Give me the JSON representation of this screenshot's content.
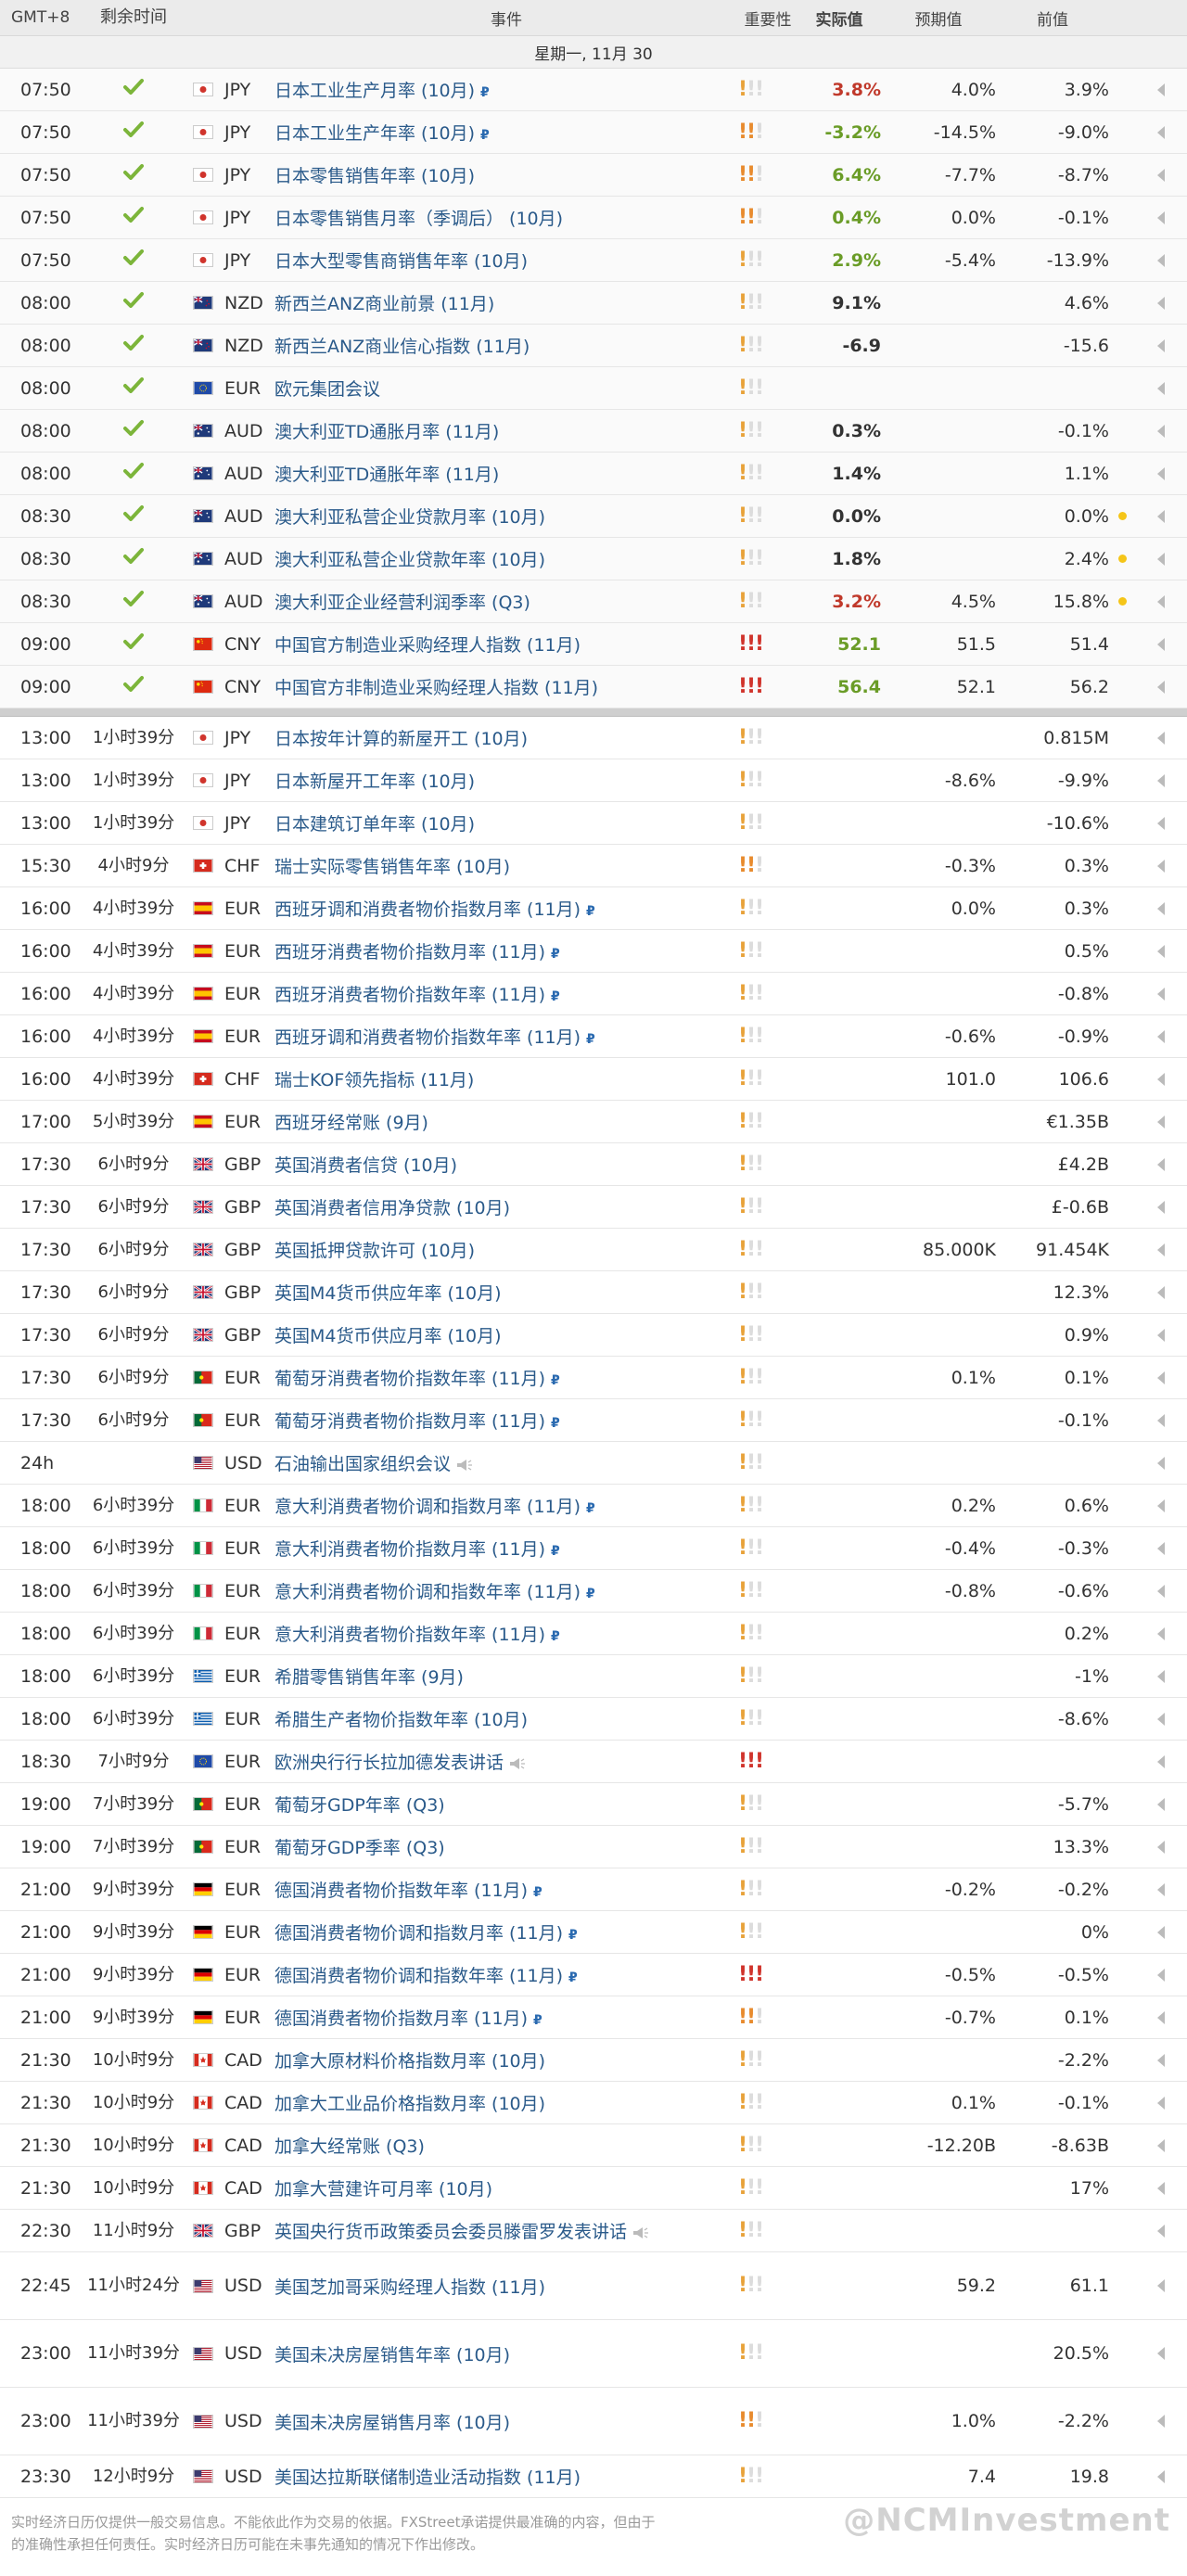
{
  "header": {
    "tz": "GMT+8",
    "remain": "剩余时间",
    "event": "事件",
    "importance": "重要性",
    "actual": "实际值",
    "forecast": "预期值",
    "previous": "前值"
  },
  "date": "星期一, 11月 30",
  "done_rows": [
    {
      "time": "07:50",
      "flag": "jp",
      "cur": "JPY",
      "event": "日本工业生产月率 (10月)",
      "rev": true,
      "imp": 1,
      "actual": "3.8%",
      "actual_class": "neg",
      "forecast": "4.0%",
      "previous": "3.9%",
      "dot": false
    },
    {
      "time": "07:50",
      "flag": "jp",
      "cur": "JPY",
      "event": "日本工业生产年率 (10月)",
      "rev": true,
      "imp": 2,
      "actual": "-3.2%",
      "actual_class": "pos",
      "forecast": "-14.5%",
      "previous": "-9.0%",
      "dot": false
    },
    {
      "time": "07:50",
      "flag": "jp",
      "cur": "JPY",
      "event": "日本零售销售年率 (10月)",
      "rev": false,
      "imp": 2,
      "actual": "6.4%",
      "actual_class": "pos",
      "forecast": "-7.7%",
      "previous": "-8.7%",
      "dot": false
    },
    {
      "time": "07:50",
      "flag": "jp",
      "cur": "JPY",
      "event": "日本零售销售月率（季调后） (10月)",
      "rev": false,
      "imp": 2,
      "actual": "0.4%",
      "actual_class": "pos",
      "forecast": "0.0%",
      "previous": "-0.1%",
      "dot": false
    },
    {
      "time": "07:50",
      "flag": "jp",
      "cur": "JPY",
      "event": "日本大型零售商销售年率 (10月)",
      "rev": false,
      "imp": 1,
      "actual": "2.9%",
      "actual_class": "pos",
      "forecast": "-5.4%",
      "previous": "-13.9%",
      "dot": false
    },
    {
      "time": "08:00",
      "flag": "nz",
      "cur": "NZD",
      "event": "新西兰ANZ商业前景 (11月)",
      "rev": false,
      "imp": 0,
      "actual": "9.1%",
      "actual_class": "",
      "forecast": "",
      "previous": "4.6%",
      "dot": false
    },
    {
      "time": "08:00",
      "flag": "nz",
      "cur": "NZD",
      "event": "新西兰ANZ商业信心指数 (11月)",
      "rev": false,
      "imp": 0,
      "actual": "-6.9",
      "actual_class": "",
      "forecast": "",
      "previous": "-15.6",
      "dot": false
    },
    {
      "time": "08:00",
      "flag": "eu",
      "cur": "EUR",
      "event": "欧元集团会议",
      "rev": false,
      "imp": 0,
      "actual": "",
      "actual_class": "",
      "forecast": "",
      "previous": "",
      "dot": false
    },
    {
      "time": "08:00",
      "flag": "au",
      "cur": "AUD",
      "event": "澳大利亚TD通胀月率 (11月)",
      "rev": false,
      "imp": 0,
      "actual": "0.3%",
      "actual_class": "",
      "forecast": "",
      "previous": "-0.1%",
      "dot": false
    },
    {
      "time": "08:00",
      "flag": "au",
      "cur": "AUD",
      "event": "澳大利亚TD通胀年率 (11月)",
      "rev": false,
      "imp": 0,
      "actual": "1.4%",
      "actual_class": "",
      "forecast": "",
      "previous": "1.1%",
      "dot": false
    },
    {
      "time": "08:30",
      "flag": "au",
      "cur": "AUD",
      "event": "澳大利亚私营企业贷款月率 (10月)",
      "rev": false,
      "imp": 0,
      "actual": "0.0%",
      "actual_class": "",
      "forecast": "",
      "previous": "0.0%",
      "dot": true
    },
    {
      "time": "08:30",
      "flag": "au",
      "cur": "AUD",
      "event": "澳大利亚私营企业贷款年率 (10月)",
      "rev": false,
      "imp": 0,
      "actual": "1.8%",
      "actual_class": "",
      "forecast": "",
      "previous": "2.4%",
      "dot": true
    },
    {
      "time": "08:30",
      "flag": "au",
      "cur": "AUD",
      "event": "澳大利亚企业经营利润季率 (Q3)",
      "rev": false,
      "imp": 0,
      "actual": "3.2%",
      "actual_class": "neg",
      "forecast": "4.5%",
      "previous": "15.8%",
      "dot": true
    },
    {
      "time": "09:00",
      "flag": "cn",
      "cur": "CNY",
      "event": "中国官方制造业采购经理人指数 (11月)",
      "rev": false,
      "imp": 3,
      "actual": "52.1",
      "actual_class": "pos",
      "forecast": "51.5",
      "previous": "51.4",
      "dot": false
    },
    {
      "time": "09:00",
      "flag": "cn",
      "cur": "CNY",
      "event": "中国官方非制造业采购经理人指数 (11月)",
      "rev": false,
      "imp": 3,
      "actual": "56.4",
      "actual_class": "pos",
      "forecast": "52.1",
      "previous": "56.2",
      "dot": false
    }
  ],
  "pending_rows": [
    {
      "time": "13:00",
      "remain": "1小时39分",
      "flag": "jp",
      "cur": "JPY",
      "event": "日本按年计算的新屋开工 (10月)",
      "rev": false,
      "speech": false,
      "imp": 0,
      "forecast": "",
      "previous": "0.815M",
      "tall": false
    },
    {
      "time": "13:00",
      "remain": "1小时39分",
      "flag": "jp",
      "cur": "JPY",
      "event": "日本新屋开工年率 (10月)",
      "rev": false,
      "speech": false,
      "imp": 0,
      "forecast": "-8.6%",
      "previous": "-9.9%",
      "tall": false
    },
    {
      "time": "13:00",
      "remain": "1小时39分",
      "flag": "jp",
      "cur": "JPY",
      "event": "日本建筑订单年率 (10月)",
      "rev": false,
      "speech": false,
      "imp": 0,
      "forecast": "",
      "previous": "-10.6%",
      "tall": false
    },
    {
      "time": "15:30",
      "remain": "4小时9分",
      "flag": "ch",
      "cur": "CHF",
      "event": "瑞士实际零售销售年率 (10月)",
      "rev": false,
      "speech": false,
      "imp": 2,
      "forecast": "-0.3%",
      "previous": "0.3%",
      "tall": false
    },
    {
      "time": "16:00",
      "remain": "4小时39分",
      "flag": "es",
      "cur": "EUR",
      "event": "西班牙调和消费者物价指数月率 (11月)",
      "rev": true,
      "speech": false,
      "imp": 1,
      "forecast": "0.0%",
      "previous": "0.3%",
      "tall": false
    },
    {
      "time": "16:00",
      "remain": "4小时39分",
      "flag": "es",
      "cur": "EUR",
      "event": "西班牙消费者物价指数月率 (11月)",
      "rev": true,
      "speech": false,
      "imp": 1,
      "forecast": "",
      "previous": "0.5%",
      "tall": false
    },
    {
      "time": "16:00",
      "remain": "4小时39分",
      "flag": "es",
      "cur": "EUR",
      "event": "西班牙消费者物价指数年率 (11月)",
      "rev": true,
      "speech": false,
      "imp": 1,
      "forecast": "",
      "previous": "-0.8%",
      "tall": false
    },
    {
      "time": "16:00",
      "remain": "4小时39分",
      "flag": "es",
      "cur": "EUR",
      "event": "西班牙调和消费者物价指数年率 (11月)",
      "rev": true,
      "speech": false,
      "imp": 1,
      "forecast": "-0.6%",
      "previous": "-0.9%",
      "tall": false
    },
    {
      "time": "16:00",
      "remain": "4小时39分",
      "flag": "ch",
      "cur": "CHF",
      "event": "瑞士KOF领先指标 (11月)",
      "rev": false,
      "speech": false,
      "imp": 1,
      "forecast": "101.0",
      "previous": "106.6",
      "tall": false
    },
    {
      "time": "17:00",
      "remain": "5小时39分",
      "flag": "es",
      "cur": "EUR",
      "event": "西班牙经常账 (9月)",
      "rev": false,
      "speech": false,
      "imp": 0,
      "forecast": "",
      "previous": "€1.35B",
      "tall": false
    },
    {
      "time": "17:30",
      "remain": "6小时9分",
      "flag": "gb",
      "cur": "GBP",
      "event": "英国消费者信贷 (10月)",
      "rev": false,
      "speech": false,
      "imp": 1,
      "forecast": "",
      "previous": "£4.2B",
      "tall": false
    },
    {
      "time": "17:30",
      "remain": "6小时9分",
      "flag": "gb",
      "cur": "GBP",
      "event": "英国消费者信用净贷款 (10月)",
      "rev": false,
      "speech": false,
      "imp": 1,
      "forecast": "",
      "previous": "£-0.6B",
      "tall": false
    },
    {
      "time": "17:30",
      "remain": "6小时9分",
      "flag": "gb",
      "cur": "GBP",
      "event": "英国抵押贷款许可 (10月)",
      "rev": false,
      "speech": false,
      "imp": 1,
      "forecast": "85.000K",
      "previous": "91.454K",
      "tall": false
    },
    {
      "time": "17:30",
      "remain": "6小时9分",
      "flag": "gb",
      "cur": "GBP",
      "event": "英国M4货币供应年率 (10月)",
      "rev": false,
      "speech": false,
      "imp": 1,
      "forecast": "",
      "previous": "12.3%",
      "tall": false
    },
    {
      "time": "17:30",
      "remain": "6小时9分",
      "flag": "gb",
      "cur": "GBP",
      "event": "英国M4货币供应月率 (10月)",
      "rev": false,
      "speech": false,
      "imp": 1,
      "forecast": "",
      "previous": "0.9%",
      "tall": false
    },
    {
      "time": "17:30",
      "remain": "6小时9分",
      "flag": "pt",
      "cur": "EUR",
      "event": "葡萄牙消费者物价指数年率 (11月)",
      "rev": true,
      "speech": false,
      "imp": 1,
      "forecast": "0.1%",
      "previous": "0.1%",
      "tall": false
    },
    {
      "time": "17:30",
      "remain": "6小时9分",
      "flag": "pt",
      "cur": "EUR",
      "event": "葡萄牙消费者物价指数月率 (11月)",
      "rev": true,
      "speech": false,
      "imp": 1,
      "forecast": "",
      "previous": "-0.1%",
      "tall": false
    },
    {
      "time": "24h",
      "remain": "",
      "flag": "us",
      "cur": "USD",
      "event": "石油输出国家组织会议",
      "rev": false,
      "speech": true,
      "imp": 0,
      "forecast": "",
      "previous": "",
      "tall": false
    },
    {
      "time": "18:00",
      "remain": "6小时39分",
      "flag": "it",
      "cur": "EUR",
      "event": "意大利消费者物价调和指数月率 (11月)",
      "rev": true,
      "speech": false,
      "imp": 1,
      "forecast": "0.2%",
      "previous": "0.6%",
      "tall": false
    },
    {
      "time": "18:00",
      "remain": "6小时39分",
      "flag": "it",
      "cur": "EUR",
      "event": "意大利消费者物价指数月率 (11月)",
      "rev": true,
      "speech": false,
      "imp": 1,
      "forecast": "-0.4%",
      "previous": "-0.3%",
      "tall": false
    },
    {
      "time": "18:00",
      "remain": "6小时39分",
      "flag": "it",
      "cur": "EUR",
      "event": "意大利消费者物价调和指数年率 (11月)",
      "rev": true,
      "speech": false,
      "imp": 1,
      "forecast": "-0.8%",
      "previous": "-0.6%",
      "tall": false
    },
    {
      "time": "18:00",
      "remain": "6小时39分",
      "flag": "it",
      "cur": "EUR",
      "event": "意大利消费者物价指数年率 (11月)",
      "rev": true,
      "speech": false,
      "imp": 1,
      "forecast": "",
      "previous": "0.2%",
      "tall": false
    },
    {
      "time": "18:00",
      "remain": "6小时39分",
      "flag": "gr",
      "cur": "EUR",
      "event": "希腊零售销售年率 (9月)",
      "rev": false,
      "speech": false,
      "imp": 1,
      "forecast": "",
      "previous": "-1%",
      "tall": false
    },
    {
      "time": "18:00",
      "remain": "6小时39分",
      "flag": "gr",
      "cur": "EUR",
      "event": "希腊生产者物价指数年率 (10月)",
      "rev": false,
      "speech": false,
      "imp": 1,
      "forecast": "",
      "previous": "-8.6%",
      "tall": false
    },
    {
      "time": "18:30",
      "remain": "7小时9分",
      "flag": "eu",
      "cur": "EUR",
      "event": "欧洲央行行长拉加德发表讲话",
      "rev": false,
      "speech": true,
      "imp": 3,
      "forecast": "",
      "previous": "",
      "tall": false
    },
    {
      "time": "19:00",
      "remain": "7小时39分",
      "flag": "pt",
      "cur": "EUR",
      "event": "葡萄牙GDP年率 (Q3)",
      "rev": false,
      "speech": false,
      "imp": 1,
      "forecast": "",
      "previous": "-5.7%",
      "tall": false
    },
    {
      "time": "19:00",
      "remain": "7小时39分",
      "flag": "pt",
      "cur": "EUR",
      "event": "葡萄牙GDP季率 (Q3)",
      "rev": false,
      "speech": false,
      "imp": 1,
      "forecast": "",
      "previous": "13.3%",
      "tall": false
    },
    {
      "time": "21:00",
      "remain": "9小时39分",
      "flag": "de",
      "cur": "EUR",
      "event": "德国消费者物价指数年率 (11月)",
      "rev": true,
      "speech": false,
      "imp": 1,
      "forecast": "-0.2%",
      "previous": "-0.2%",
      "tall": false
    },
    {
      "time": "21:00",
      "remain": "9小时39分",
      "flag": "de",
      "cur": "EUR",
      "event": "德国消费者物价调和指数月率 (11月)",
      "rev": true,
      "speech": false,
      "imp": 1,
      "forecast": "",
      "previous": "0%",
      "tall": false
    },
    {
      "time": "21:00",
      "remain": "9小时39分",
      "flag": "de",
      "cur": "EUR",
      "event": "德国消费者物价调和指数年率 (11月)",
      "rev": true,
      "speech": false,
      "imp": 3,
      "forecast": "-0.5%",
      "previous": "-0.5%",
      "tall": false
    },
    {
      "time": "21:00",
      "remain": "9小时39分",
      "flag": "de",
      "cur": "EUR",
      "event": "德国消费者物价指数月率 (11月)",
      "rev": true,
      "speech": false,
      "imp": 2,
      "forecast": "-0.7%",
      "previous": "0.1%",
      "tall": false
    },
    {
      "time": "21:30",
      "remain": "10小时9分",
      "flag": "ca",
      "cur": "CAD",
      "event": "加拿大原材料价格指数月率 (10月)",
      "rev": false,
      "speech": false,
      "imp": 1,
      "forecast": "",
      "previous": "-2.2%",
      "tall": false
    },
    {
      "time": "21:30",
      "remain": "10小时9分",
      "flag": "ca",
      "cur": "CAD",
      "event": "加拿大工业品价格指数月率 (10月)",
      "rev": false,
      "speech": false,
      "imp": 1,
      "forecast": "0.1%",
      "previous": "-0.1%",
      "tall": false
    },
    {
      "time": "21:30",
      "remain": "10小时9分",
      "flag": "ca",
      "cur": "CAD",
      "event": "加拿大经常账 (Q3)",
      "rev": false,
      "speech": false,
      "imp": 1,
      "forecast": "-12.20B",
      "previous": "-8.63B",
      "tall": false
    },
    {
      "time": "21:30",
      "remain": "10小时9分",
      "flag": "ca",
      "cur": "CAD",
      "event": "加拿大营建许可月率 (10月)",
      "rev": false,
      "speech": false,
      "imp": 1,
      "forecast": "",
      "previous": "17%",
      "tall": false
    },
    {
      "time": "22:30",
      "remain": "11小时9分",
      "flag": "gb",
      "cur": "GBP",
      "event": "英国央行货币政策委员会委员滕雷罗发表讲话",
      "rev": false,
      "speech": true,
      "imp": 0,
      "forecast": "",
      "previous": "",
      "tall": false
    },
    {
      "time": "22:45",
      "remain": "11小时24分",
      "flag": "us",
      "cur": "USD",
      "event": "美国芝加哥采购经理人指数 (11月)",
      "rev": false,
      "speech": false,
      "imp": 1,
      "forecast": "59.2",
      "previous": "61.1",
      "tall": true
    },
    {
      "time": "23:00",
      "remain": "11小时39分",
      "flag": "us",
      "cur": "USD",
      "event": "美国未决房屋销售年率 (10月)",
      "rev": false,
      "speech": false,
      "imp": 1,
      "forecast": "",
      "previous": "20.5%",
      "tall": true
    },
    {
      "time": "23:00",
      "remain": "11小时39分",
      "flag": "us",
      "cur": "USD",
      "event": "美国未决房屋销售月率 (10月)",
      "rev": false,
      "speech": false,
      "imp": 2,
      "forecast": "1.0%",
      "previous": "-2.2%",
      "tall": true
    },
    {
      "time": "23:30",
      "remain": "12小时9分",
      "flag": "us",
      "cur": "USD",
      "event": "美国达拉斯联储制造业活动指数 (11月)",
      "rev": false,
      "speech": false,
      "imp": 1,
      "forecast": "7.4",
      "previous": "19.8",
      "tall": false
    }
  ],
  "footer": {
    "line1": "实时经济日历仅提供一般交易信息。不能依此作为交易的依据。FXStreet承诺提供最准确的内容，但由于",
    "line2": "的准确性承担任何责任。实时经济日历可能在未事先通知的情况下作出修改。",
    "watermark": "@NCMInvestment"
  },
  "colors": {
    "positive": "#6a9c27",
    "negative": "#c0392b",
    "link": "#2a5a8a",
    "importance_low": "#e8a23a",
    "importance_high": "#d0342c"
  }
}
